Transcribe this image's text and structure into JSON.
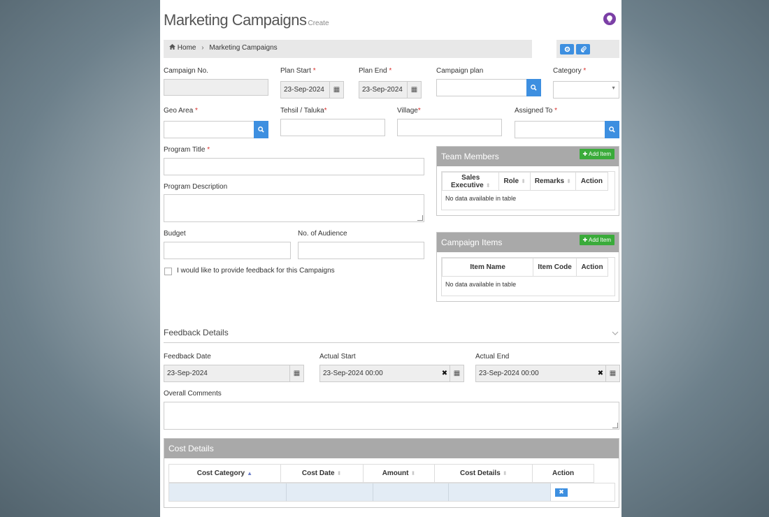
{
  "header": {
    "title": "Marketing Campaigns",
    "subtitle": "Create",
    "help_icon": "lightbulb-icon"
  },
  "breadcrumb": {
    "home_label": "Home",
    "current_label": "Marketing Campaigns",
    "separator": "›"
  },
  "toolbar": {
    "buttons": [
      "settings-icon",
      "paperclip-icon"
    ]
  },
  "form": {
    "campaign_no": {
      "label": "Campaign No.",
      "value": ""
    },
    "plan_start": {
      "label": "Plan Start",
      "required": "*",
      "value": "23-Sep-2024"
    },
    "plan_end": {
      "label": "Plan End",
      "required": "*",
      "value": "23-Sep-2024"
    },
    "campaign_plan": {
      "label": "Campaign plan",
      "value": ""
    },
    "category": {
      "label": "Category",
      "required": "*",
      "value": ""
    },
    "geo_area": {
      "label": "Geo Area",
      "required": "*",
      "value": ""
    },
    "tehsil": {
      "label": "Tehsil / Taluka",
      "required": "*",
      "value": ""
    },
    "village": {
      "label": "Village",
      "required": "*",
      "value": ""
    },
    "assigned_to": {
      "label": "Assigned To",
      "required": "*",
      "value": ""
    },
    "program_title": {
      "label": "Program Title",
      "required": "*",
      "value": ""
    },
    "program_description": {
      "label": "Program Description",
      "value": ""
    },
    "budget": {
      "label": "Budget",
      "value": ""
    },
    "audience": {
      "label": "No. of Audience",
      "value": ""
    },
    "feedback_checkbox": {
      "label": "I would like to provide feedback for this Campaigns",
      "checked": false
    }
  },
  "team_members": {
    "title": "Team Members",
    "add_label": "Add Item",
    "columns": [
      "Sales Executive",
      "Role",
      "Remarks",
      "Action"
    ],
    "empty_text": "No data available in table"
  },
  "campaign_items": {
    "title": "Campaign Items",
    "add_label": "Add Item",
    "columns": [
      "Item Name",
      "Item Code",
      "Action"
    ],
    "empty_text": "No data available in table"
  },
  "feedback": {
    "title": "Feedback Details",
    "feedback_date": {
      "label": "Feedback Date",
      "value": "23-Sep-2024"
    },
    "actual_start": {
      "label": "Actual Start",
      "value": "23-Sep-2024 00:00"
    },
    "actual_end": {
      "label": "Actual End",
      "value": "23-Sep-2024 00:00"
    },
    "overall_comments": {
      "label": "Overall Comments",
      "value": ""
    }
  },
  "cost_details": {
    "title": "Cost Details",
    "columns": [
      "Cost Category",
      "Cost Date",
      "Amount",
      "Cost Details",
      "Action"
    ],
    "row_highlight": "#e3ecf5"
  },
  "colors": {
    "primary": "#3d8fe0",
    "success": "#3aab3a",
    "panel_header": "#a9a9a9",
    "help": "#7b3fa6",
    "required": "#d9302c"
  }
}
